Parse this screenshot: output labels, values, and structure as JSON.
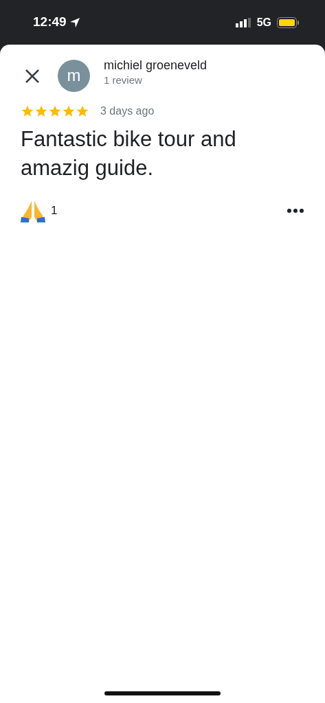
{
  "status_bar": {
    "time": "12:49",
    "network": "5G"
  },
  "review": {
    "avatar_letter": "m",
    "author": "michiel groeneveld",
    "review_count": "1 review",
    "stars": 5,
    "date": "3 days ago",
    "text": "Fantastic bike tour and amazig guide.",
    "reaction_count": "1"
  }
}
